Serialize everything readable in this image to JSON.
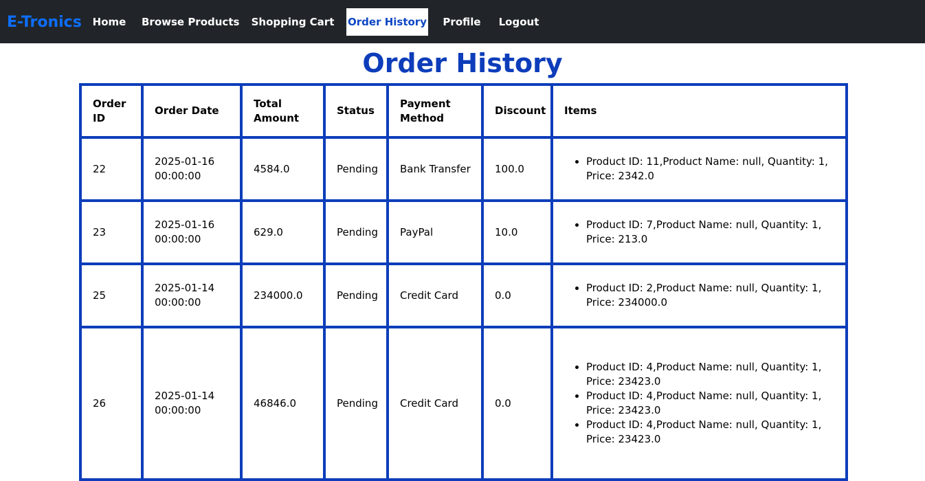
{
  "nav": {
    "brand": "E-Tronics",
    "items": [
      {
        "label": "Home",
        "name": "nav-home"
      },
      {
        "label": "Browse Products",
        "name": "nav-browse-products"
      },
      {
        "label": "Shopping Cart",
        "name": "nav-shopping-cart"
      },
      {
        "label": "Order History",
        "name": "nav-order-history",
        "active": true
      },
      {
        "label": "Profile",
        "name": "nav-profile"
      },
      {
        "label": "Logout",
        "name": "nav-logout"
      }
    ]
  },
  "page": {
    "title": "Order History"
  },
  "colors": {
    "navbar_bg": "#212529",
    "brand": "#0d6efd",
    "accent": "#0d3dba"
  },
  "table": {
    "headers": [
      "Order ID",
      "Order Date",
      "Total Amount",
      "Status",
      "Payment Method",
      "Discount",
      "Items"
    ],
    "rows": [
      {
        "order_id": "22",
        "order_date": "2025-01-16 00:00:00",
        "total_amount": "4584.0",
        "status": "Pending",
        "payment_method": "Bank Transfer",
        "discount": "100.0",
        "items": [
          "Product ID: 11,Product Name: null, Quantity: 1, Price: 2342.0"
        ]
      },
      {
        "order_id": "23",
        "order_date": "2025-01-16 00:00:00",
        "total_amount": "629.0",
        "status": "Pending",
        "payment_method": "PayPal",
        "discount": "10.0",
        "items": [
          "Product ID: 7,Product Name: null, Quantity: 1, Price: 213.0"
        ]
      },
      {
        "order_id": "25",
        "order_date": "2025-01-14 00:00:00",
        "total_amount": "234000.0",
        "status": "Pending",
        "payment_method": "Credit Card",
        "discount": "0.0",
        "items": [
          "Product ID: 2,Product Name: null, Quantity: 1, Price: 234000.0"
        ]
      },
      {
        "order_id": "26",
        "order_date": "2025-01-14 00:00:00",
        "total_amount": "46846.0",
        "status": "Pending",
        "payment_method": "Credit Card",
        "discount": "0.0",
        "items": [
          "Product ID: 4,Product Name: null, Quantity: 1, Price: 23423.0",
          "Product ID: 4,Product Name: null, Quantity: 1, Price: 23423.0",
          "Product ID: 4,Product Name: null, Quantity: 1, Price: 23423.0"
        ]
      }
    ]
  }
}
